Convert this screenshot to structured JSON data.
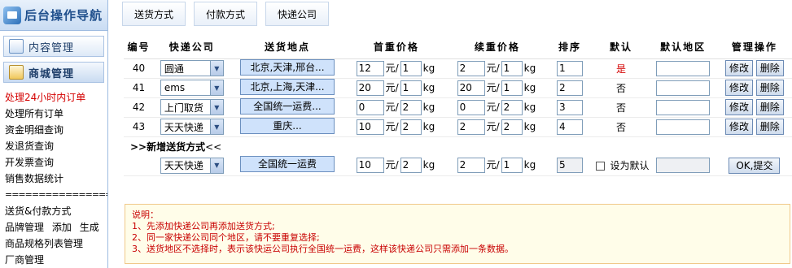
{
  "brand": {
    "title": "后台操作导航"
  },
  "groups": [
    {
      "label": "内容管理"
    },
    {
      "label": "商城管理"
    }
  ],
  "links": {
    "orders24": "处理24小时内订单",
    "all_orders": "处理所有订单",
    "funds": "资金明细查询",
    "shipping": "发退货查询",
    "invoice": "开发票查询",
    "sales": "销售数据统计",
    "separator": "======================",
    "ship_pay": "送货&付款方式",
    "brand_mgmt": "品牌管理",
    "brand_add": "添加",
    "brand_gen": "生成",
    "spec_list": "商品规格列表管理",
    "vendor": "厂商管理"
  },
  "tabs": [
    "送货方式",
    "付款方式",
    "快递公司"
  ],
  "headers": {
    "id": "编号",
    "company": "快递公司",
    "area": "送货地点",
    "first": "首重价格",
    "next": "续重价格",
    "order": "排序",
    "default": "默认",
    "default_area": "默认地区",
    "ops": "管理操作"
  },
  "unit_yuan": "元/",
  "unit_kg": "kg",
  "rows": [
    {
      "id": "40",
      "company": "圆通",
      "area": "北京,天津,邢台...",
      "first_price": "12",
      "first_weight": "1",
      "next_price": "2",
      "next_weight": "1",
      "order": "1",
      "default": "是",
      "default_area": "",
      "edit": "修改",
      "del": "删除"
    },
    {
      "id": "41",
      "company": "ems",
      "area": "北京,上海,天津...",
      "first_price": "20",
      "first_weight": "1",
      "next_price": "20",
      "next_weight": "1",
      "order": "2",
      "default": "否",
      "default_area": "",
      "edit": "修改",
      "del": "删除"
    },
    {
      "id": "42",
      "company": "上门取货",
      "area": "全国统一运费...",
      "first_price": "0",
      "first_weight": "2",
      "next_price": "0",
      "next_weight": "2",
      "order": "3",
      "default": "否",
      "default_area": "",
      "edit": "修改",
      "del": "删除"
    },
    {
      "id": "43",
      "company": "天天快递",
      "area": "重庆...",
      "first_price": "10",
      "first_weight": "2",
      "next_price": "2",
      "next_weight": "2",
      "order": "4",
      "default": "否",
      "default_area": "",
      "edit": "修改",
      "del": "删除"
    }
  ],
  "new_section": {
    "title": ">>新增送货方式",
    "tail": "<<"
  },
  "new_row": {
    "company": "天天快递",
    "area": "全国统一运费",
    "first_price": "10",
    "first_weight": "2",
    "next_price": "2",
    "next_weight": "1",
    "order": "5",
    "set_default": "设为默认",
    "submit": "OK,提交"
  },
  "note": {
    "title": "说明：",
    "lines": [
      "1、先添加快递公司再添加送货方式;",
      "2、同一家快递公司同个地区，请不要重复选择;",
      "3、送货地区不选择时，表示该快运公司执行全国统一运费，这样该快递公司只需添加一条数据。"
    ]
  }
}
